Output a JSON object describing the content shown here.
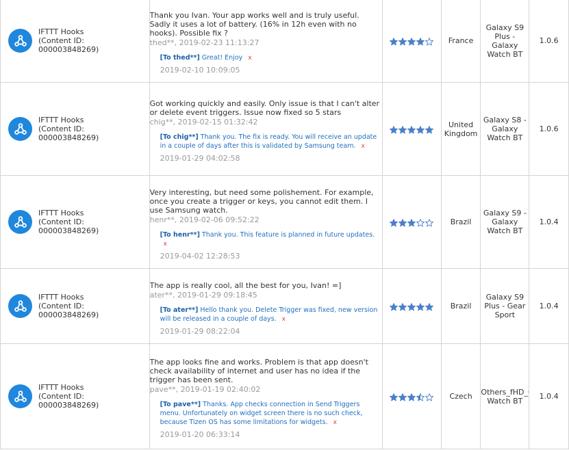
{
  "colors": {
    "accent": "#1f87dc",
    "star": "#4b7fc9",
    "reply_text": "#1f6fbf",
    "delete_x": "#e23b3b"
  },
  "rows": [
    {
      "app": {
        "icon": "webhooks-icon",
        "name": "IFTTT Hooks",
        "content_id_label": "(Content ID:",
        "content_id": "000003848269)"
      },
      "review": {
        "text": "Thank you Ivan. Your app works well and is truly useful. Sadly it uses a lot of battery. (16% in 12h even with no hooks). Possible fix ?",
        "author_date": "thed**, 2019-02-23 11:13:27"
      },
      "reply": {
        "to": "[To thed**]",
        "text": "Great! Enjoy",
        "delete_icon": "x",
        "date": "2019-02-10 10:09:05"
      },
      "rating": 4,
      "country": "France",
      "device": "Galaxy S9 Plus - Galaxy Watch BT",
      "version": "1.0.6"
    },
    {
      "app": {
        "icon": "webhooks-icon",
        "name": "IFTTT Hooks",
        "content_id_label": "(Content ID:",
        "content_id": "000003848269)"
      },
      "review": {
        "text": "Got working quickly and easily. Only issue is that I can't alter or delete event triggers. Issue now fixed so 5 stars",
        "author_date": "chig**, 2019-02-15 01:32:42"
      },
      "reply": {
        "to": "[To chig**]",
        "text": "Thank you. The fix is ready. You will receive an update in a couple of days after this is validated by Samsung team.",
        "delete_icon": "x",
        "date": "2019-01-29 04:02:58"
      },
      "rating": 5,
      "country": "United Kingdom",
      "device": "Galaxy S8 - Galaxy Watch BT",
      "version": "1.0.6"
    },
    {
      "app": {
        "icon": "webhooks-icon",
        "name": "IFTTT Hooks",
        "content_id_label": "(Content ID:",
        "content_id": "000003848269)"
      },
      "review": {
        "text": "Very interesting, but need some polishement. For example, once you create a trigger or keys, you cannot edit them. I use Samsung watch.",
        "author_date": "henr**, 2019-02-06 09:52:22"
      },
      "reply": {
        "to": "[To henr**]",
        "text": "Thank you. This feature is planned in future updates.",
        "delete_icon": "x",
        "date": "2019-04-02 12:28:53"
      },
      "rating": 3,
      "country": "Brazil",
      "device": "Galaxy S9 - Galaxy Watch BT",
      "version": "1.0.4"
    },
    {
      "app": {
        "icon": "webhooks-icon",
        "name": "IFTTT Hooks",
        "content_id_label": "(Content ID:",
        "content_id": "000003848269)"
      },
      "review": {
        "text": "The app is really cool, all the best for you, Ivan! =]",
        "author_date": "ater**, 2019-01-29 09:18:45"
      },
      "reply": {
        "to": "[To ater**]",
        "text": "Hello thank you. Delete Trigger was fixed, new version will be released in a couple of days.",
        "delete_icon": "x",
        "date": "2019-01-29 08:22:04"
      },
      "rating": 5,
      "country": "Brazil",
      "device": "Galaxy S9 Plus - Gear Sport",
      "version": "1.0.4"
    },
    {
      "app": {
        "icon": "webhooks-icon",
        "name": "IFTTT Hooks",
        "content_id_label": "(Content ID:",
        "content_id": "000003848269)"
      },
      "review": {
        "text": "The app looks fine and works. Problem is that app doesn't check availability of internet and user has no idea if the trigger has been sent.",
        "author_date": "pave**, 2019-01-19 02:40:02"
      },
      "reply": {
        "to": "[To pave**]",
        "text": "Thanks. App checks connection in Send Triggers menu. Unfortunately on widget screen there is no such check, because Tizen OS has some limitations for widgets.",
        "delete_icon": "x",
        "date": "2019-01-20 06:33:14"
      },
      "rating": 3.5,
      "country": "Czech",
      "device": "Others_fHD_Galaxy Watch BT",
      "version": "1.0.4"
    }
  ]
}
